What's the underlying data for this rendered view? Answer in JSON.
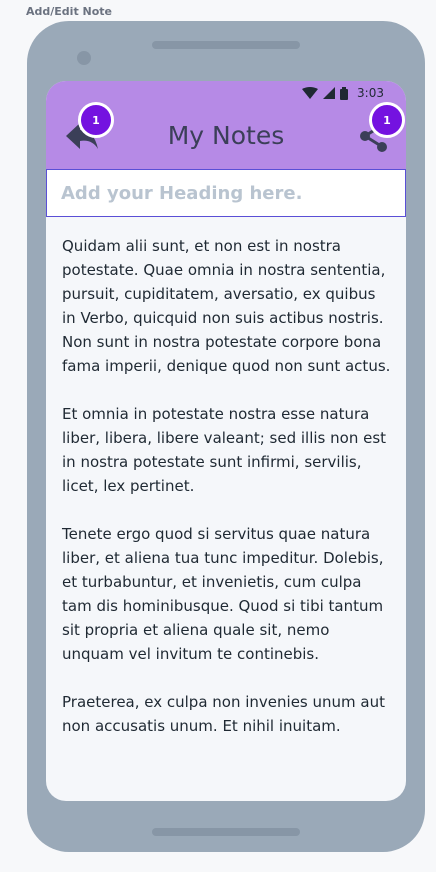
{
  "frame_label": "Add/Edit Note",
  "status_bar": {
    "time": "3:03",
    "icons": [
      "wifi-icon",
      "signal-icon",
      "battery-icon"
    ]
  },
  "appbar": {
    "title": "My Notes",
    "back_badge": "1",
    "share_badge": "1",
    "background": "#b68ae6"
  },
  "heading_input": {
    "placeholder": "Add your Heading here.",
    "value": ""
  },
  "note": {
    "paragraphs": [
      "Quidam alii sunt, et non est in nostra potestate. Quae omnia in nostra sententia, pursuit, cupiditatem, aversatio, ex quibus in Verbo, quicquid non suis actibus nostris. Non sunt in nostra potestate corpore bona fama imperii, denique quod non sunt actus.",
      "Et omnia in potestate nostra esse natura liber, libera, libere valeant; sed illis non est in nostra potestate sunt infirmi, servilis, licet, lex pertinet.",
      "Tenete ergo quod si servitus quae natura liber, et aliena tua tunc impeditur. Dolebis, et turbabuntur, et invenietis, cum culpa tam dis hominibusque. Quod si tibi tantum sit propria et aliena quale sit, nemo unquam vel invitum te continebis.",
      "Praeterea, ex culpa non invenies unum aut non accusatis unum. Et nihil inuitam."
    ]
  },
  "colors": {
    "accent": "#7412e0",
    "device": "#9aa9b8",
    "input_border": "#5a4fd6"
  }
}
